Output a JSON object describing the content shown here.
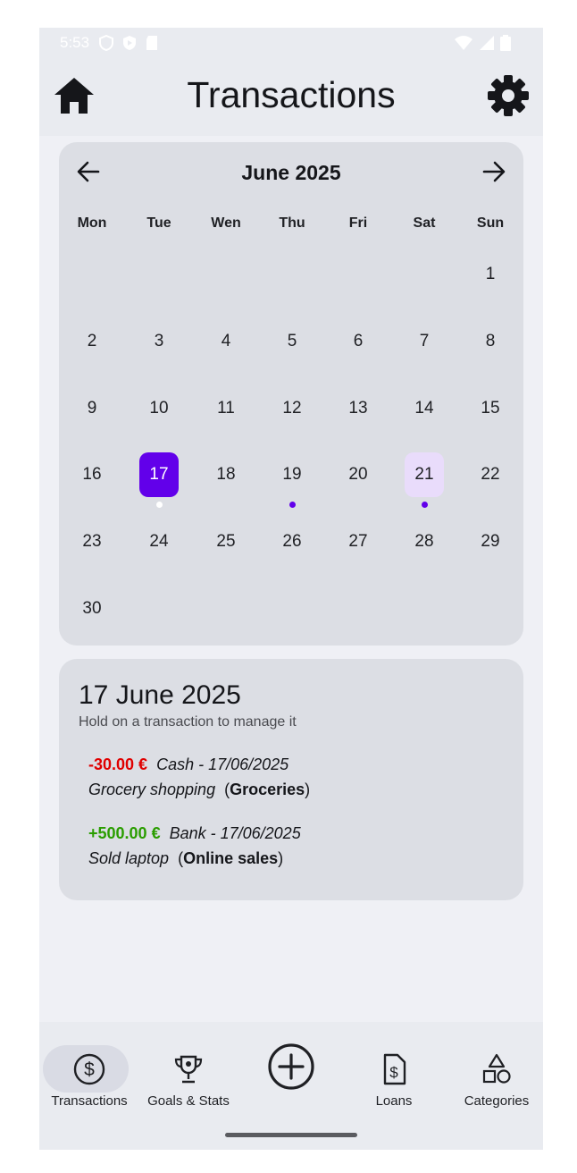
{
  "status_bar": {
    "time": "5:53"
  },
  "app_bar": {
    "title": "Transactions",
    "left_icon": "home-icon",
    "right_icon": "gear-icon"
  },
  "calendar": {
    "month_label": "June 2025",
    "weekdays": [
      "Mon",
      "Tue",
      "Wen",
      "Thu",
      "Fri",
      "Sat",
      "Sun"
    ],
    "days": [
      "1",
      "2",
      "3",
      "4",
      "5",
      "6",
      "7",
      "8",
      "9",
      "10",
      "11",
      "12",
      "13",
      "14",
      "15",
      "16",
      "17",
      "18",
      "19",
      "20",
      "21",
      "22",
      "23",
      "24",
      "25",
      "26",
      "27",
      "28",
      "29",
      "30"
    ],
    "selected_day": "17",
    "highlighted_day": "21",
    "days_with_transactions": [
      "17",
      "19",
      "21"
    ],
    "colors": {
      "selected": "#6200ea",
      "highlight": "#e9dcfb",
      "dot": "#6200ea"
    }
  },
  "detail": {
    "date": "17 June 2025",
    "hint": "Hold on a transaction to manage it",
    "transactions": [
      {
        "amount": "-30.00 €",
        "meta": "Cash - 17/06/2025",
        "description": "Grocery shopping",
        "category": "Groceries",
        "color": "#e00000"
      },
      {
        "amount": "+500.00 €",
        "meta": "Bank - 17/06/2025",
        "description": "Sold laptop",
        "category": "Online sales",
        "color": "#2a9d00"
      }
    ]
  },
  "bottom_nav": {
    "items": [
      {
        "label": "Transactions",
        "icon": "dollar-circle-icon",
        "active": true
      },
      {
        "label": "Goals & Stats",
        "icon": "trophy-icon",
        "active": false
      },
      {
        "label": "",
        "icon": "add-circle-icon",
        "active": false
      },
      {
        "label": "Loans",
        "icon": "invoice-icon",
        "active": false
      },
      {
        "label": "Categories",
        "icon": "shapes-icon",
        "active": false
      }
    ]
  }
}
